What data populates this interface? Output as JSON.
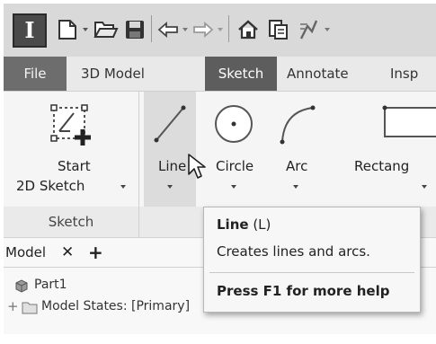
{
  "app": {
    "logo_letter": "I"
  },
  "quick_access": {
    "icons": [
      "new-file-icon",
      "open-folder-icon",
      "save-icon",
      "undo-icon",
      "redo-icon",
      "home-icon",
      "properties-icon",
      "adaptive-icon"
    ]
  },
  "tabs": [
    {
      "label": "File"
    },
    {
      "label": "3D Model"
    },
    {
      "label": "Sketch",
      "active": true
    },
    {
      "label": "Annotate"
    },
    {
      "label": "Insp"
    }
  ],
  "ribbon": {
    "start_sketch": {
      "line1": "Start",
      "line2": "2D Sketch"
    },
    "panel_sketch_label": "Sketch",
    "tools": [
      {
        "label": "Line"
      },
      {
        "label": "Circle"
      },
      {
        "label": "Arc"
      },
      {
        "label": "Rectang"
      }
    ]
  },
  "browser": {
    "tab_model": "Model",
    "close_symbol": "✕",
    "add_symbol": "+",
    "items": [
      {
        "label": "Part1"
      },
      {
        "expand": "+",
        "label": "Model States: [Primary]"
      }
    ]
  },
  "tooltip": {
    "title": "Line",
    "shortcut": " (L)",
    "description": "Creates lines and arcs.",
    "help": "Press F1 for more help"
  },
  "colors": {
    "active_tab": "#5d5d5d",
    "file_tab": "#6d6d6d",
    "ribbon_bg": "#f5f5f5",
    "hover_highlight": "#dcdcdc"
  }
}
